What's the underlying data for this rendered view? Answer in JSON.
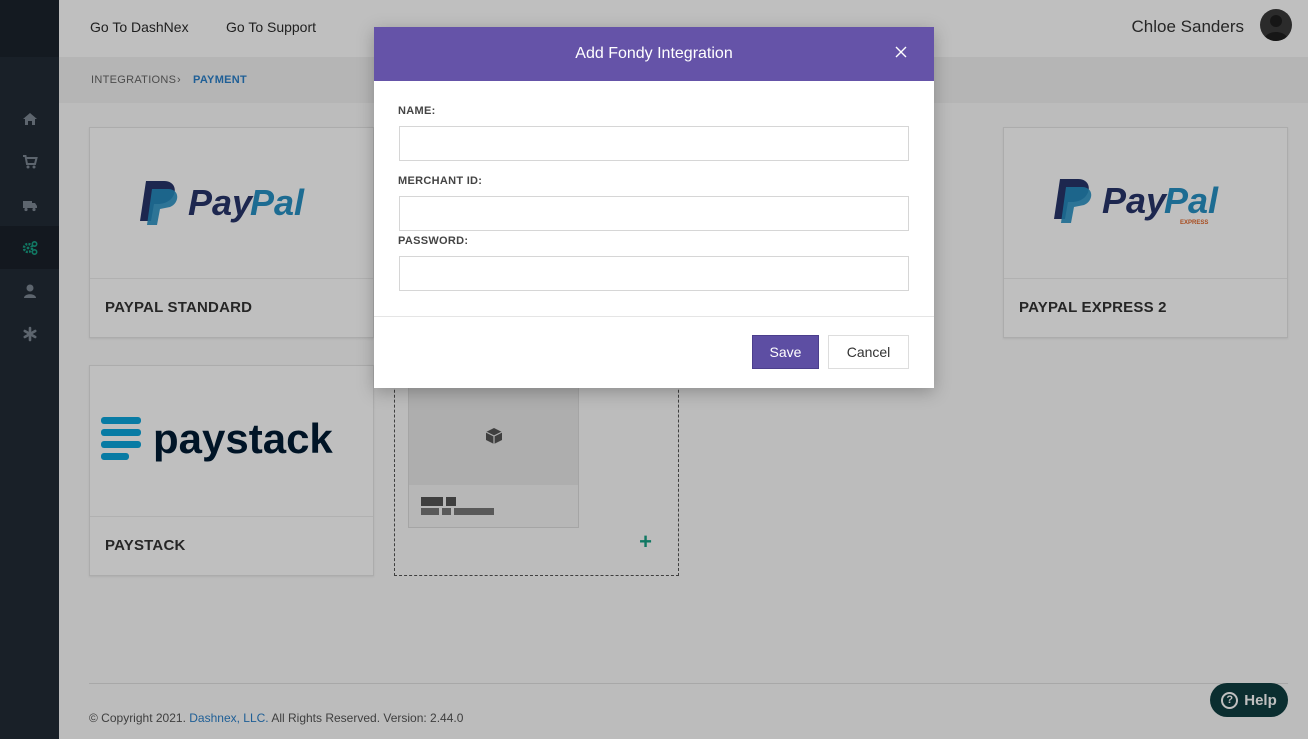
{
  "header": {
    "links": [
      "Go To DashNex",
      "Go To Support"
    ],
    "user_name": "Chloe Sanders"
  },
  "breadcrumb": {
    "parent": "INTEGRATIONS",
    "separator": "›",
    "current": "PAYMENT"
  },
  "sidebar": {
    "items": [
      {
        "icon": "home-icon"
      },
      {
        "icon": "cart-icon"
      },
      {
        "icon": "truck-icon"
      },
      {
        "icon": "gears-icon",
        "active": true
      },
      {
        "icon": "user-icon"
      },
      {
        "icon": "asterisk-icon"
      }
    ]
  },
  "cards": [
    {
      "title": "PAYPAL STANDARD",
      "logo_text": "PayPal"
    },
    {
      "title": "PAYPAL EXPRESS 2",
      "logo_text": "PayPal",
      "logo_sub": "EXPRESS"
    },
    {
      "title": "PAYSTACK",
      "logo_text": "paystack"
    }
  ],
  "add_card": {
    "plus_label": "+"
  },
  "footer": {
    "prefix": "© Copyright 2021.",
    "company": "Dashnex, LLC.",
    "suffix": "All Rights Reserved. Version: 2.44.0"
  },
  "help": {
    "label": "Help"
  },
  "modal": {
    "title": "Add Fondy Integration",
    "close_label": "×",
    "fields": [
      {
        "label": "NAME:",
        "value": ""
      },
      {
        "label": "MERCHANT ID:",
        "value": ""
      },
      {
        "label": "PASSWORD:",
        "value": ""
      }
    ],
    "save_label": "Save",
    "cancel_label": "Cancel"
  },
  "colors": {
    "modal_header": "#6553a8",
    "save_button": "#5d4ea3",
    "accent_link": "#2a7fc9",
    "sidebar_active_icon": "#17a085"
  }
}
